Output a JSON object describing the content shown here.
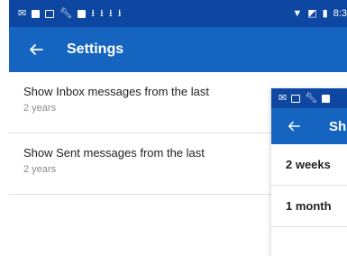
{
  "status_bar": {
    "left_icons": [
      "email-icon",
      "message-icon",
      "sim-icon",
      "wrench-icon",
      "briefcase-icon",
      "download-icon",
      "download-icon",
      "download-icon",
      "download-icon"
    ],
    "time": "8:3"
  },
  "header": {
    "title": "Settings"
  },
  "settings": {
    "items": [
      {
        "title": "Show Inbox messages from the last",
        "value": "2 years"
      },
      {
        "title": "Show Sent messages from the last",
        "value": "2 years"
      }
    ]
  },
  "overlay": {
    "title_partial": "Sh",
    "options": [
      "2 weeks",
      "1 month"
    ]
  },
  "colors": {
    "status_bar": "#0d47a1",
    "app_bar": "#1565c0"
  }
}
